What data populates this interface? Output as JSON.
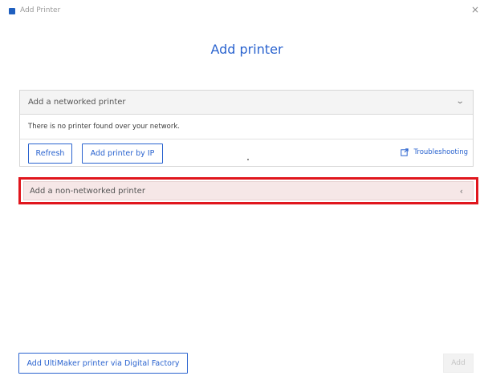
{
  "window": {
    "title": "Add Printer",
    "close_glyph": "×"
  },
  "heading": "Add printer",
  "networked": {
    "header_label": "Add a networked printer",
    "expanded_glyph": "⌄",
    "empty_message": "There is no printer found over your network.",
    "refresh_label": "Refresh",
    "add_by_ip_label": "Add printer by IP",
    "troubleshooting_label": "Troubleshooting",
    "troubleshooting_icon": "external-link-icon"
  },
  "non_networked": {
    "header_label": "Add a non-networked printer",
    "collapsed_glyph": "‹",
    "highlight_color": "#e0161d"
  },
  "footer": {
    "digital_factory_label": "Add UltiMaker printer via Digital Factory",
    "add_label": "Add"
  },
  "colors": {
    "accent": "#2a63cf",
    "highlight": "#e0161d"
  }
}
